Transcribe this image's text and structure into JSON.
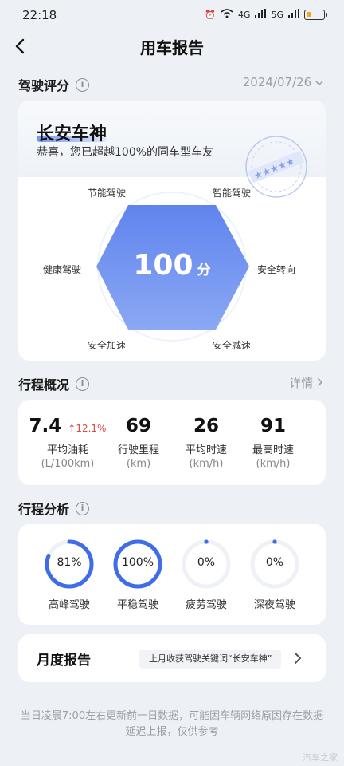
{
  "status_bar": {
    "time": "22:18",
    "network": "4G",
    "network2": "5G"
  },
  "header": {
    "title": "用车报告"
  },
  "driving_score": {
    "section_title": "驾驶评分",
    "date": "2024/07/26",
    "rank_title": "长安车神",
    "subtitle": "恭喜，您已超越100%的同车型车友",
    "score": "100",
    "score_unit": "分",
    "dimensions": [
      "节能驾驶",
      "智能驾驶",
      "安全转向",
      "安全减速",
      "安全加速",
      "健康驾驶"
    ]
  },
  "trip_overview": {
    "section_title": "行程概况",
    "details_label": "详情",
    "metrics": [
      {
        "value": "7.4",
        "change": "↑12.1%",
        "label": "平均油耗",
        "unit": "(L/100km)"
      },
      {
        "value": "69",
        "label": "行驶里程",
        "unit": "(km)"
      },
      {
        "value": "26",
        "label": "平均时速",
        "unit": "(km/h)"
      },
      {
        "value": "91",
        "label": "最高时速",
        "unit": "(km/h)"
      }
    ]
  },
  "trip_analysis": {
    "section_title": "行程分析",
    "items": [
      {
        "percent_text": "81%",
        "percent": 0.81,
        "label": "高峰驾驶"
      },
      {
        "percent_text": "100%",
        "percent": 1.0,
        "label": "平稳驾驶"
      },
      {
        "percent_text": "0%",
        "percent": 0,
        "label": "疲劳驾驶"
      },
      {
        "percent_text": "0%",
        "percent": 0,
        "label": "深夜驾驶"
      }
    ]
  },
  "monthly_report": {
    "title": "月度报告",
    "tag": "上月收获驾驶关键词“长安车神”"
  },
  "footer_note": "当日凌晨7:00左右更新前一日数据，可能因车辆网络原因存在数据延迟上报，仅供参考",
  "watermark": "汽车之家",
  "colors": {
    "accent": "#3f6de8",
    "hex_fill": "#6b8ff0",
    "ring_track": "#eef1f6",
    "up_change": "#d94a4a"
  }
}
